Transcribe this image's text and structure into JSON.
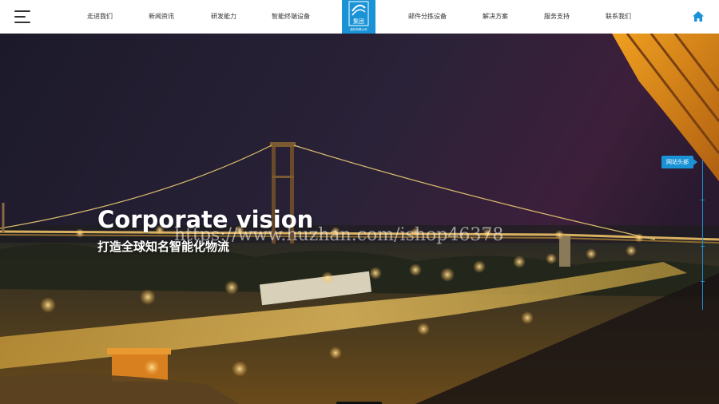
{
  "header": {
    "nav_left": [
      "走进我们",
      "新闻资讯",
      "研发能力",
      "智能终端设备"
    ],
    "nav_right": [
      "邮件分拣设备",
      "解决方案",
      "服务支持",
      "联系我们"
    ],
    "logo_text": "集团",
    "logo_subtext": "股份有限公司"
  },
  "hero": {
    "title": "Corporate vision",
    "subtitle": "打造全球知名智能化物流",
    "watermark": "https://www.huzhan.com/ishop46378"
  },
  "side_nav": {
    "label": "网站头部"
  },
  "colors": {
    "accent": "#1a93d6",
    "header_bg": "#ffffff",
    "nav_text": "#333333"
  },
  "icons": {
    "menu": "hamburger-menu-icon",
    "home": "home-icon",
    "logo": "logo-icon"
  }
}
